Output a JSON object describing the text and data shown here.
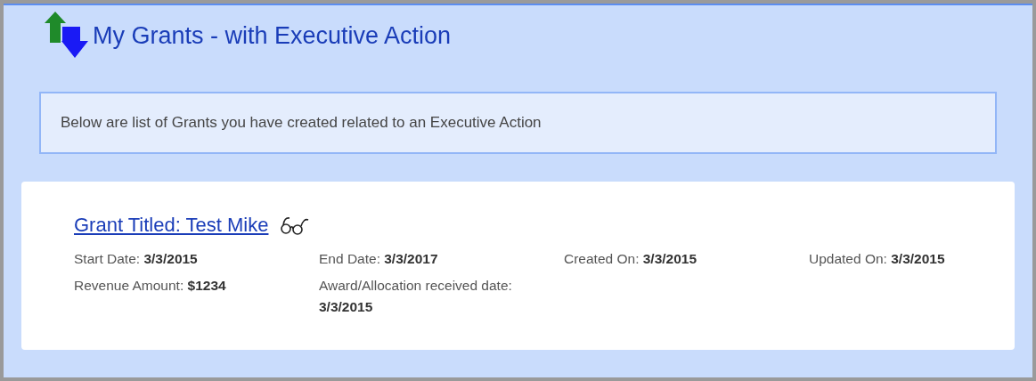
{
  "page": {
    "title": "My Grants - with Executive Action"
  },
  "notice": "Below are list of Grants you have created related to an Executive Action",
  "grants": [
    {
      "title": "Grant Titled: Test Mike",
      "fields": [
        {
          "label": "Start Date:",
          "value": "3/3/2015"
        },
        {
          "label": "End Date:",
          "value": "3/3/2017"
        },
        {
          "label": "Created On:",
          "value": "3/3/2015"
        },
        {
          "label": "Updated On:",
          "value": "3/3/2015"
        },
        {
          "label": "Revenue Amount:",
          "value": "$1234"
        },
        {
          "label": "Award/Allocation received date:",
          "value": "3/3/2015"
        }
      ]
    }
  ]
}
